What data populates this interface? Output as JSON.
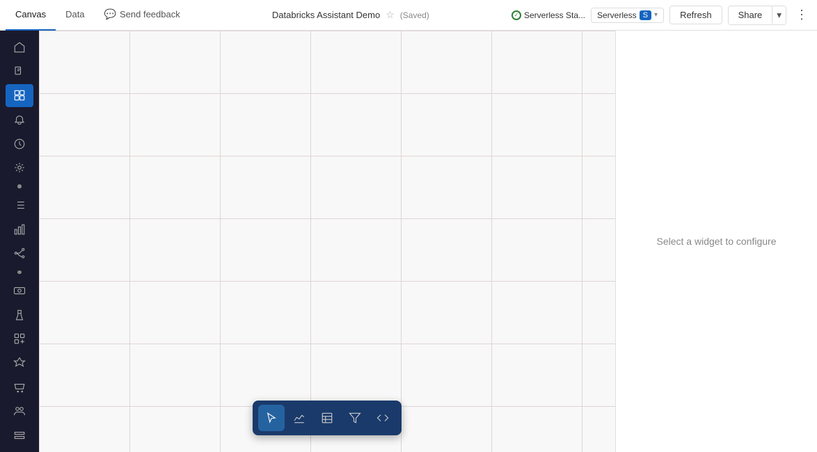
{
  "topbar": {
    "tabs": [
      {
        "id": "canvas",
        "label": "Canvas",
        "active": true
      },
      {
        "id": "data",
        "label": "Data",
        "active": false
      }
    ],
    "send_feedback_label": "Send feedback",
    "dashboard_title": "Databricks Assistant Demo",
    "saved_badge": "(Saved)",
    "cluster_status_text": "Serverless Sta...",
    "cluster_type": "Serverless",
    "cluster_size": "S",
    "refresh_label": "Refresh",
    "share_label": "Share"
  },
  "sidebar": {
    "items": [
      {
        "id": "home",
        "icon": "home"
      },
      {
        "id": "files",
        "icon": "files"
      },
      {
        "id": "dashboard",
        "icon": "dashboard",
        "active": true
      },
      {
        "id": "alerts",
        "icon": "bell"
      },
      {
        "id": "recents",
        "icon": "clock"
      },
      {
        "id": "ai",
        "icon": "ai"
      },
      {
        "id": "dot1",
        "type": "dot"
      },
      {
        "id": "queries",
        "icon": "list"
      },
      {
        "id": "charts",
        "icon": "chart"
      },
      {
        "id": "workflows",
        "icon": "workflow"
      },
      {
        "id": "dot2",
        "type": "dot"
      },
      {
        "id": "compute",
        "icon": "compute"
      },
      {
        "id": "experiments",
        "icon": "flask"
      },
      {
        "id": "models",
        "icon": "models"
      },
      {
        "id": "features",
        "icon": "features"
      },
      {
        "id": "marketplace",
        "icon": "marketplace"
      },
      {
        "id": "partners",
        "icon": "partners"
      },
      {
        "id": "data-icon",
        "icon": "data"
      }
    ]
  },
  "canvas": {
    "right_panel_text": "Select a widget to configure"
  },
  "widget_toolbar": {
    "tools": [
      {
        "id": "pointer",
        "label": "Pointer",
        "active": true
      },
      {
        "id": "line-chart",
        "label": "Line Chart",
        "active": false
      },
      {
        "id": "table",
        "label": "Table",
        "active": false
      },
      {
        "id": "filter",
        "label": "Filter",
        "active": false
      },
      {
        "id": "code",
        "label": "Code",
        "active": false
      }
    ]
  }
}
